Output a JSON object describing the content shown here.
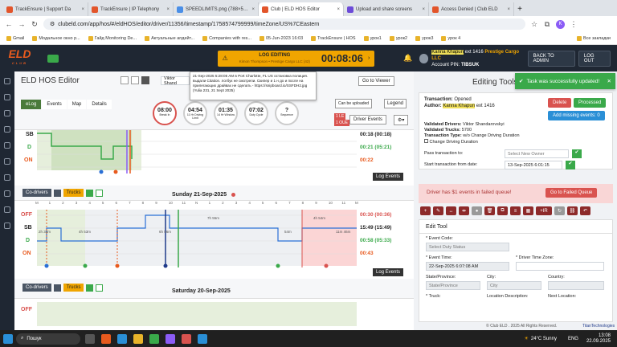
{
  "tabs": [
    {
      "title": "TrackEnsure | Support Da",
      "color": "#e2552b"
    },
    {
      "title": "TrackEnsure | IP Telephony",
      "color": "#e2552b"
    },
    {
      "title": "SPEEDLIMITS.png (788×5…",
      "color": "#4a8fe7"
    },
    {
      "title": "Club | ELD HOS Editor",
      "color": "#e2552b"
    },
    {
      "title": "Upload and share screens",
      "color": "#6c4bd8"
    },
    {
      "title": "Access Denied | Club ELD",
      "color": "#e2552b"
    }
  ],
  "url": "clubeld.com/app/hos/#/eldHOS/editor/driver/11356/timestamp/1758574799999/timeZone/US%7CEastern",
  "bookmarks": [
    "Gmail",
    "Модальное окно р...",
    "Гайд Monitoring De...",
    "Актуальные апдейт...",
    "Companies with res...",
    "05-Jun-2023 16:03",
    "TrackEnsure | HOS",
    "урок1",
    "урок2",
    "урок3",
    "урок 4",
    "Все закладки"
  ],
  "header": {
    "log_editing": "LOG EDITING",
    "log_sub": "Kimon Thompson • Prestige Cargo LLC (42)",
    "timer": "00:08:06",
    "user": "Kanna Khapun",
    "ext": "ext 1416",
    "company": "Prestige Cargo LLC",
    "account_pin_label": "Account PIN:",
    "account_pin": "TIBSUK",
    "back_admin": "BACK TO ADMIN",
    "logout": "LOG OUT",
    "logo": "ELD",
    "logo_sub": "CLUB"
  },
  "editor": {
    "title": "ELD HOS Editor",
    "driver_select": "Viktor Shand",
    "go_viewer": "Go to Viewer",
    "tabs": [
      "eLog",
      "Events",
      "Map",
      "Details"
    ],
    "driver_events": "Driver Events",
    "legend": "Legend",
    "can_be_uploaded": "Can be uploaded",
    "badge1": "1 LE",
    "badge2": "1 OUE"
  },
  "tooltip": "21-Sep-2025 5:28:05 AM в Port Charlotte, FL US остановка полиция. выдали Citation. логбук не смотрели. Скипер и 1 н до и после на прилегающих драйвах не сделать - https://snipboard.io/SSFDH2.jpg (Yulia 231, 21 Sept 2025)",
  "circles": [
    {
      "v": "08:00",
      "l": "Break In"
    },
    {
      "v": "04:54",
      "l": "11 Hr Driving Limit"
    },
    {
      "v": "01:35",
      "l": "14 Hr Window"
    },
    {
      "v": "07:02",
      "l": "Duty Cycle"
    },
    {
      "v": "?",
      "l": "Sequence"
    }
  ],
  "day1": {
    "rows": [
      "SB",
      "D",
      "ON"
    ],
    "totals": [
      "00:18 (00:18)",
      "00:21 (05:21)",
      "00:22"
    ]
  },
  "day2": {
    "date": "Sunday 21-Sep-2025",
    "rows": [
      "OFF",
      "SB",
      "D",
      "ON"
    ],
    "totals": [
      "00:30 (00:36)",
      "15:49 (15:49)",
      "00:58 (05:33)",
      "00:43"
    ],
    "hours": [
      "M",
      "1",
      "2",
      "3",
      "4",
      "5",
      "6",
      "7",
      "8",
      "9",
      "10",
      "11",
      "N",
      "1",
      "2",
      "3",
      "4",
      "5",
      "6",
      "7",
      "8",
      "9",
      "10",
      "11",
      "M"
    ],
    "seg_labels": [
      "2h 34m",
      "7h 55m",
      "4h 54m",
      "4h 53m",
      "6h 56m",
      "54m",
      "11m 46m"
    ]
  },
  "day3": {
    "date": "Saturday 20-Sep-2025",
    "rows": [
      "OFF"
    ]
  },
  "common": {
    "co_drivers": "Co-drivers",
    "trucks": "Trucks",
    "log_events": "Log Events"
  },
  "tools": {
    "title": "Editing Tools",
    "toast": "Task was successfully updated!",
    "transaction": "Transaction:",
    "transaction_v": "Opened",
    "author": "Author:",
    "author_v": "Kanna Khapun",
    "author_ext": "ext 1416",
    "delete": "Delete",
    "processed": "Processed",
    "add_missing": "Add missing events: 0",
    "validated_drivers": "Validated Drivers:",
    "validated_drivers_v": "Viktor Shandarovskyi",
    "validated_trucks": "Validated Trucks:",
    "validated_trucks_v": "5700",
    "transaction_type": "Transaction Type:",
    "transaction_type_v": "w/o Change Driving Duration",
    "change_driving": "Change Driving Duration",
    "pass_to": "Pass transaction to:",
    "select_owner": "Select New Owner",
    "start_from": "Start transaction from date:",
    "start_date": "13-Sep-2025 6:01:15",
    "failed_msg": "Driver has $1 events in failed queue!",
    "failed_btn": "Go to Failed Queue",
    "edit_tool": "Edit Tool",
    "event_code": "* Event Code:",
    "event_code_ph": "Select Duty Status",
    "event_time": "* Event Time:",
    "event_time_v": "22-Sep-2025 6:07:08 AM",
    "tz": "* Driver Time Zone:",
    "state": "State/Province:",
    "state_ph": "State/Province",
    "city": "City:",
    "city_ph": "City",
    "country": "Country:",
    "truck": "* Truck:",
    "location": "Location Description:",
    "next_location": "Next Location:",
    "footer": "© Club ELD . 2025 All Rights Reserved.",
    "brand": "TitanTechnologies"
  },
  "taskbar": {
    "search": "Пошук",
    "weather": "24°C Sunny",
    "lang": "ENG",
    "time": "13:08",
    "date": "22.09.2025"
  },
  "colors": {
    "accent": "#e85a1e",
    "danger": "#d9534f",
    "success": "#3aa94a",
    "primary": "#2a8fd6",
    "dark": "#1f2733"
  }
}
